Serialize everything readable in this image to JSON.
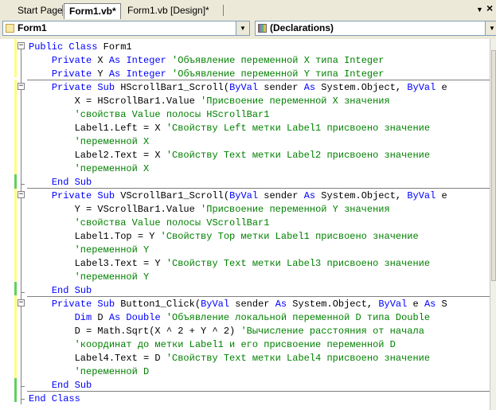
{
  "tabs": [
    {
      "label": "Start Page",
      "active": false
    },
    {
      "label": "Form1.vb*",
      "active": true
    },
    {
      "label": "Form1.vb [Design]*",
      "active": false
    }
  ],
  "window_controls": {
    "dropdown_glyph": "▼",
    "close_glyph": "×"
  },
  "dropdowns": {
    "class_name": "Form1",
    "method_name": "(Declarations)"
  },
  "code": [
    [
      {
        "t": "Public Class",
        "c": "kw"
      },
      {
        "t": " Form1",
        "c": "n"
      }
    ],
    [
      {
        "t": "    ",
        "c": "n"
      },
      {
        "t": "Private",
        "c": "kw"
      },
      {
        "t": " X ",
        "c": "n"
      },
      {
        "t": "As Integer",
        "c": "kw"
      },
      {
        "t": " 'Объявление переменной X типа Integer",
        "c": "cm"
      }
    ],
    [
      {
        "t": "    ",
        "c": "n"
      },
      {
        "t": "Private",
        "c": "kw"
      },
      {
        "t": " Y ",
        "c": "n"
      },
      {
        "t": "As Integer",
        "c": "kw"
      },
      {
        "t": " 'Объявление переменной Y типа Integer",
        "c": "cm"
      }
    ],
    [
      {
        "t": "    ",
        "c": "n"
      },
      {
        "t": "Private Sub",
        "c": "kw"
      },
      {
        "t": " HScrollBar1_Scroll(",
        "c": "n"
      },
      {
        "t": "ByVal",
        "c": "kw"
      },
      {
        "t": " sender ",
        "c": "n"
      },
      {
        "t": "As",
        "c": "kw"
      },
      {
        "t": " System.Object, ",
        "c": "n"
      },
      {
        "t": "ByVal",
        "c": "kw"
      },
      {
        "t": " e",
        "c": "n"
      }
    ],
    [
      {
        "t": "        X = HScrollBar1.Value ",
        "c": "n"
      },
      {
        "t": "'Присвоение переменной X значения",
        "c": "cm"
      }
    ],
    [
      {
        "t": "        'свойства Value полосы HScrollBar1",
        "c": "cm"
      }
    ],
    [
      {
        "t": "        Label1.Left = X ",
        "c": "n"
      },
      {
        "t": "'Свойству Left метки Label1 присвоено значение",
        "c": "cm"
      }
    ],
    [
      {
        "t": "        'переменной X",
        "c": "cm"
      }
    ],
    [
      {
        "t": "        Label2.Text = X ",
        "c": "n"
      },
      {
        "t": "'Свойству Text метки Label2 присвоено значение",
        "c": "cm"
      }
    ],
    [
      {
        "t": "        'переменной X",
        "c": "cm"
      }
    ],
    [
      {
        "t": "    ",
        "c": "n"
      },
      {
        "t": "End Sub",
        "c": "kw"
      }
    ],
    [
      {
        "t": "    ",
        "c": "n"
      },
      {
        "t": "Private Sub",
        "c": "kw"
      },
      {
        "t": " VScrollBar1_Scroll(",
        "c": "n"
      },
      {
        "t": "ByVal",
        "c": "kw"
      },
      {
        "t": " sender ",
        "c": "n"
      },
      {
        "t": "As",
        "c": "kw"
      },
      {
        "t": " System.Object, ",
        "c": "n"
      },
      {
        "t": "ByVal",
        "c": "kw"
      },
      {
        "t": " e",
        "c": "n"
      }
    ],
    [
      {
        "t": "        Y = VScrollBar1.Value ",
        "c": "n"
      },
      {
        "t": "'Присвоение переменной Y значения",
        "c": "cm"
      }
    ],
    [
      {
        "t": "        'свойства Value полосы VScrollBar1",
        "c": "cm"
      }
    ],
    [
      {
        "t": "        Label1.Top = Y ",
        "c": "n"
      },
      {
        "t": "'Свойству Top метки Label1 присвоено значение",
        "c": "cm"
      }
    ],
    [
      {
        "t": "        'переменной Y",
        "c": "cm"
      }
    ],
    [
      {
        "t": "        Label3.Text = Y ",
        "c": "n"
      },
      {
        "t": "'Свойству Text метки Label3 присвоено значение",
        "c": "cm"
      }
    ],
    [
      {
        "t": "        'переменной Y",
        "c": "cm"
      }
    ],
    [
      {
        "t": "    ",
        "c": "n"
      },
      {
        "t": "End Sub",
        "c": "kw"
      }
    ],
    [
      {
        "t": "    ",
        "c": "n"
      },
      {
        "t": "Private Sub",
        "c": "kw"
      },
      {
        "t": " Button1_Click(",
        "c": "n"
      },
      {
        "t": "ByVal",
        "c": "kw"
      },
      {
        "t": " sender ",
        "c": "n"
      },
      {
        "t": "As",
        "c": "kw"
      },
      {
        "t": " System.Object, ",
        "c": "n"
      },
      {
        "t": "ByVal",
        "c": "kw"
      },
      {
        "t": " e ",
        "c": "n"
      },
      {
        "t": "As",
        "c": "kw"
      },
      {
        "t": " S",
        "c": "n"
      }
    ],
    [
      {
        "t": "        ",
        "c": "n"
      },
      {
        "t": "Dim",
        "c": "kw"
      },
      {
        "t": " D ",
        "c": "n"
      },
      {
        "t": "As Double",
        "c": "kw"
      },
      {
        "t": " 'Объявление локальной переменной D типа Double",
        "c": "cm"
      }
    ],
    [
      {
        "t": "        D = Math.Sqrt(X ^ 2 + Y ^ 2) ",
        "c": "n"
      },
      {
        "t": "'Вычисление расстояния от начала",
        "c": "cm"
      }
    ],
    [
      {
        "t": "        'координат до метки Label1 и его присвоение переменной D",
        "c": "cm"
      }
    ],
    [
      {
        "t": "        Label4.Text = D ",
        "c": "n"
      },
      {
        "t": "'Свойству Text метки Label4 присвоено значение",
        "c": "cm"
      }
    ],
    [
      {
        "t": "        'переменной D",
        "c": "cm"
      }
    ],
    [
      {
        "t": "    ",
        "c": "n"
      },
      {
        "t": "End Sub",
        "c": "kw"
      }
    ],
    [
      {
        "t": "End Class",
        "c": "kw"
      }
    ]
  ]
}
